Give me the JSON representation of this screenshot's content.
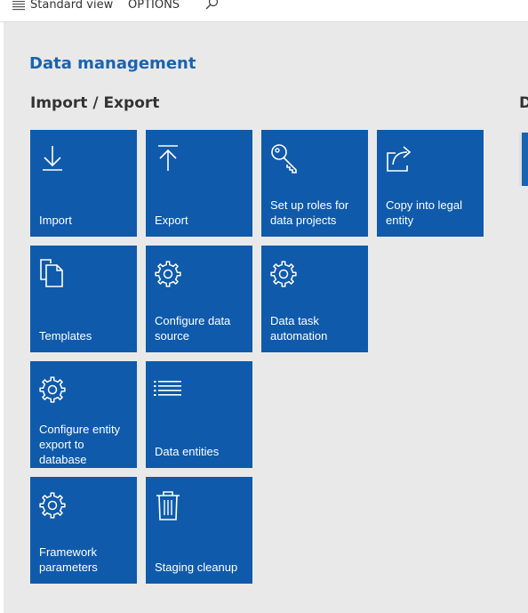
{
  "toolbar": {
    "view_label": "Standard view",
    "options_label": "OPTIONS"
  },
  "page": {
    "title": "Data management",
    "section_title": "Import / Export",
    "next_section_initial": "D"
  },
  "colors": {
    "accent": "#1a63b0",
    "tile": "#0f5aaa",
    "panel_bg": "#e9e9e9"
  },
  "tiles": [
    {
      "label": "Import",
      "icon": "download-arrow-icon"
    },
    {
      "label": "Export",
      "icon": "upload-arrow-icon"
    },
    {
      "label": "Set up roles for data projects",
      "icon": "key-icon"
    },
    {
      "label": "Copy into legal entity",
      "icon": "share-icon"
    },
    {
      "label": "Templates",
      "icon": "documents-icon"
    },
    {
      "label": "Configure data source",
      "icon": "gear-icon"
    },
    {
      "label": "Data task automation",
      "icon": "gear-icon"
    },
    {
      "label": "Configure entity export to database",
      "icon": "gear-icon"
    },
    {
      "label": "Data entities",
      "icon": "list-icon"
    },
    {
      "label": "Framework parameters",
      "icon": "gear-icon"
    },
    {
      "label": "Staging cleanup",
      "icon": "trash-icon"
    }
  ]
}
